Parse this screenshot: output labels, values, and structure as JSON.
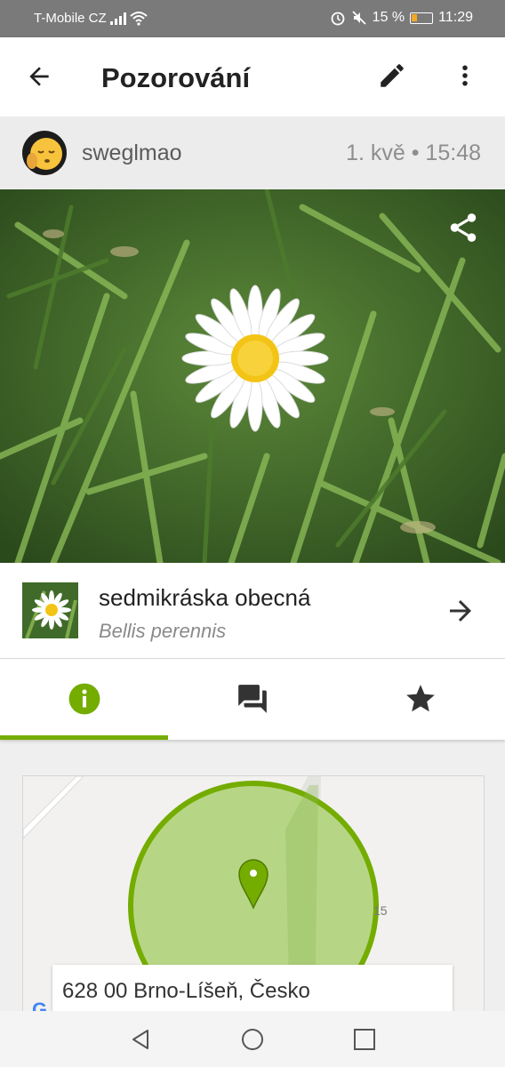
{
  "status_bar": {
    "carrier": "T-Mobile CZ",
    "battery": "15 %",
    "time": "11:29",
    "icons": [
      "signal-icon",
      "wifi-icon",
      "alarm-icon",
      "mute-icon",
      "battery-icon"
    ]
  },
  "app_bar": {
    "title": "Pozorování",
    "icons": [
      "back-arrow-icon",
      "edit-pencil-icon",
      "more-vert-icon"
    ]
  },
  "observation": {
    "username": "sweglmao",
    "date": "1. kvě • 15:48"
  },
  "species": {
    "common_name": "sedmikráska obecná",
    "scientific_name": "Bellis perennis"
  },
  "tabs": [
    {
      "name": "info",
      "icon": "info-icon",
      "active": true
    },
    {
      "name": "discussion",
      "icon": "chat-icon",
      "active": false
    },
    {
      "name": "favorite",
      "icon": "star-icon",
      "active": false
    }
  ],
  "map": {
    "address": "628 00 Brno-Líšeň, Česko",
    "scale_label": "15",
    "google_letter": "G"
  },
  "colors": {
    "accent": "#74ac00",
    "status_bar": "#7a7a7a",
    "map_circle_fill": "#b6d686",
    "map_circle_stroke": "#74ac00"
  }
}
